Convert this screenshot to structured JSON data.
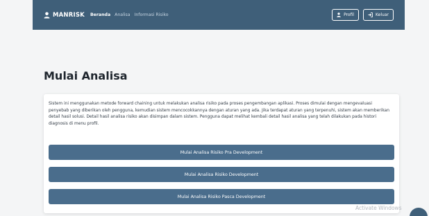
{
  "navbar": {
    "brand": "MANRISK",
    "links": [
      "Beranda",
      "Analisa",
      "Informasi Risiko"
    ],
    "profile_label": "Profil",
    "logout_label": "Keluar"
  },
  "page_title": "Mulai Analisa",
  "description": "Sistem ini menggunakan metode forward chaining untuk melakukan analisa risiko pada proses pengembangan aplikasi. Proses dimulai dengan mengevaluasi penyebab yang diberikan oleh pengguna, kemudian sistem mencocokkannya dengan aturan yang ada. Jika terdapat aturan yang terpenuhi, sistem akan memberikan detail hasil solusi. Detail hasil analisa risiko akan disimpan dalam sistem. Pengguna dapat melihat kembali detail hasil analisa yang telah dilakukan pada histori diagnosis di menu profil.",
  "buttons": [
    "Mulai Analisa Risiko Pra Development",
    "Mulai Analisa Risiko Development",
    "Mulai Analisa Risiko Pasca Development"
  ],
  "watermark": "Activate Windows",
  "colors": {
    "navbar": "#3f5f79",
    "button": "#4a6d8c",
    "background": "#f4f5f6"
  },
  "icons": {
    "brand": "user-icon",
    "profile": "user-icon",
    "logout": "logout-icon"
  }
}
